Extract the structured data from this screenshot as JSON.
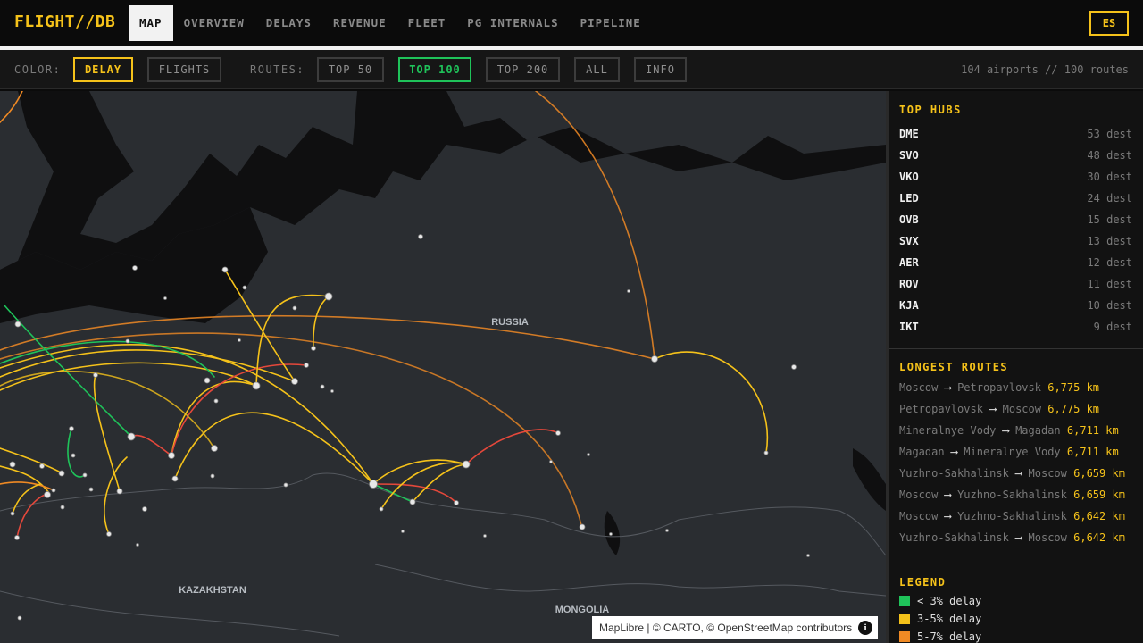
{
  "app": {
    "brand": "FLIGHT//DB",
    "lang": "ES"
  },
  "nav": [
    "MAP",
    "OVERVIEW",
    "DELAYS",
    "REVENUE",
    "FLEET",
    "PG INTERNALS",
    "PIPELINE"
  ],
  "filters": {
    "color_label": "COLOR:",
    "color_options": [
      "DELAY",
      "FLIGHTS"
    ],
    "routes_label": "ROUTES:",
    "route_options": [
      "TOP 50",
      "TOP 100",
      "TOP 200",
      "ALL"
    ],
    "info": "INFO",
    "stats": "104 airports // 100 routes"
  },
  "map": {
    "labels": [
      "RUSSIA",
      "KAZAKHSTAN",
      "MONGOLIA"
    ],
    "attribution": {
      "maplibre": "MapLibre",
      "rest": " | © CARTO, © OpenStreetMap contributors",
      "info": "i"
    }
  },
  "sidebar": {
    "top_hubs_title": "TOP HUBS",
    "top_hubs": [
      {
        "code": "DME",
        "dest": "53 dest"
      },
      {
        "code": "SVO",
        "dest": "48 dest"
      },
      {
        "code": "VKO",
        "dest": "30 dest"
      },
      {
        "code": "LED",
        "dest": "24 dest"
      },
      {
        "code": "OVB",
        "dest": "15 dest"
      },
      {
        "code": "SVX",
        "dest": "13 dest"
      },
      {
        "code": "AER",
        "dest": "12 dest"
      },
      {
        "code": "ROV",
        "dest": "11 dest"
      },
      {
        "code": "KJA",
        "dest": "10 dest"
      },
      {
        "code": "IKT",
        "dest": "9 dest"
      }
    ],
    "longest_title": "LONGEST ROUTES",
    "longest_routes": [
      {
        "from": "Moscow",
        "to": "Petropavlovsk",
        "km": "6,775 km"
      },
      {
        "from": "Petropavlovsk",
        "to": "Moscow",
        "km": "6,775 km"
      },
      {
        "from": "Mineralnye Vody",
        "to": "Magadan",
        "km": "6,711 km"
      },
      {
        "from": "Magadan",
        "to": "Mineralnye Vody",
        "km": "6,711 km"
      },
      {
        "from": "Yuzhno-Sakhalinsk",
        "to": "Moscow",
        "km": "6,659 km"
      },
      {
        "from": "Moscow",
        "to": "Yuzhno-Sakhalinsk",
        "km": "6,659 km"
      },
      {
        "from": "Moscow",
        "to": "Yuzhno-Sakhalinsk",
        "km": "6,642 km"
      },
      {
        "from": "Yuzhno-Sakhalinsk",
        "to": "Moscow",
        "km": "6,642 km"
      }
    ],
    "legend_title": "LEGEND",
    "legend": [
      {
        "label": "< 3% delay",
        "color": "#1fc35a"
      },
      {
        "label": "3-5% delay",
        "color": "#f5c21a"
      },
      {
        "label": "5-7% delay",
        "color": "#f08a24"
      }
    ]
  },
  "colors": {
    "accent": "#f5c21a",
    "green": "#1fc35a",
    "orange": "#f08a24",
    "red": "#e5483b"
  }
}
